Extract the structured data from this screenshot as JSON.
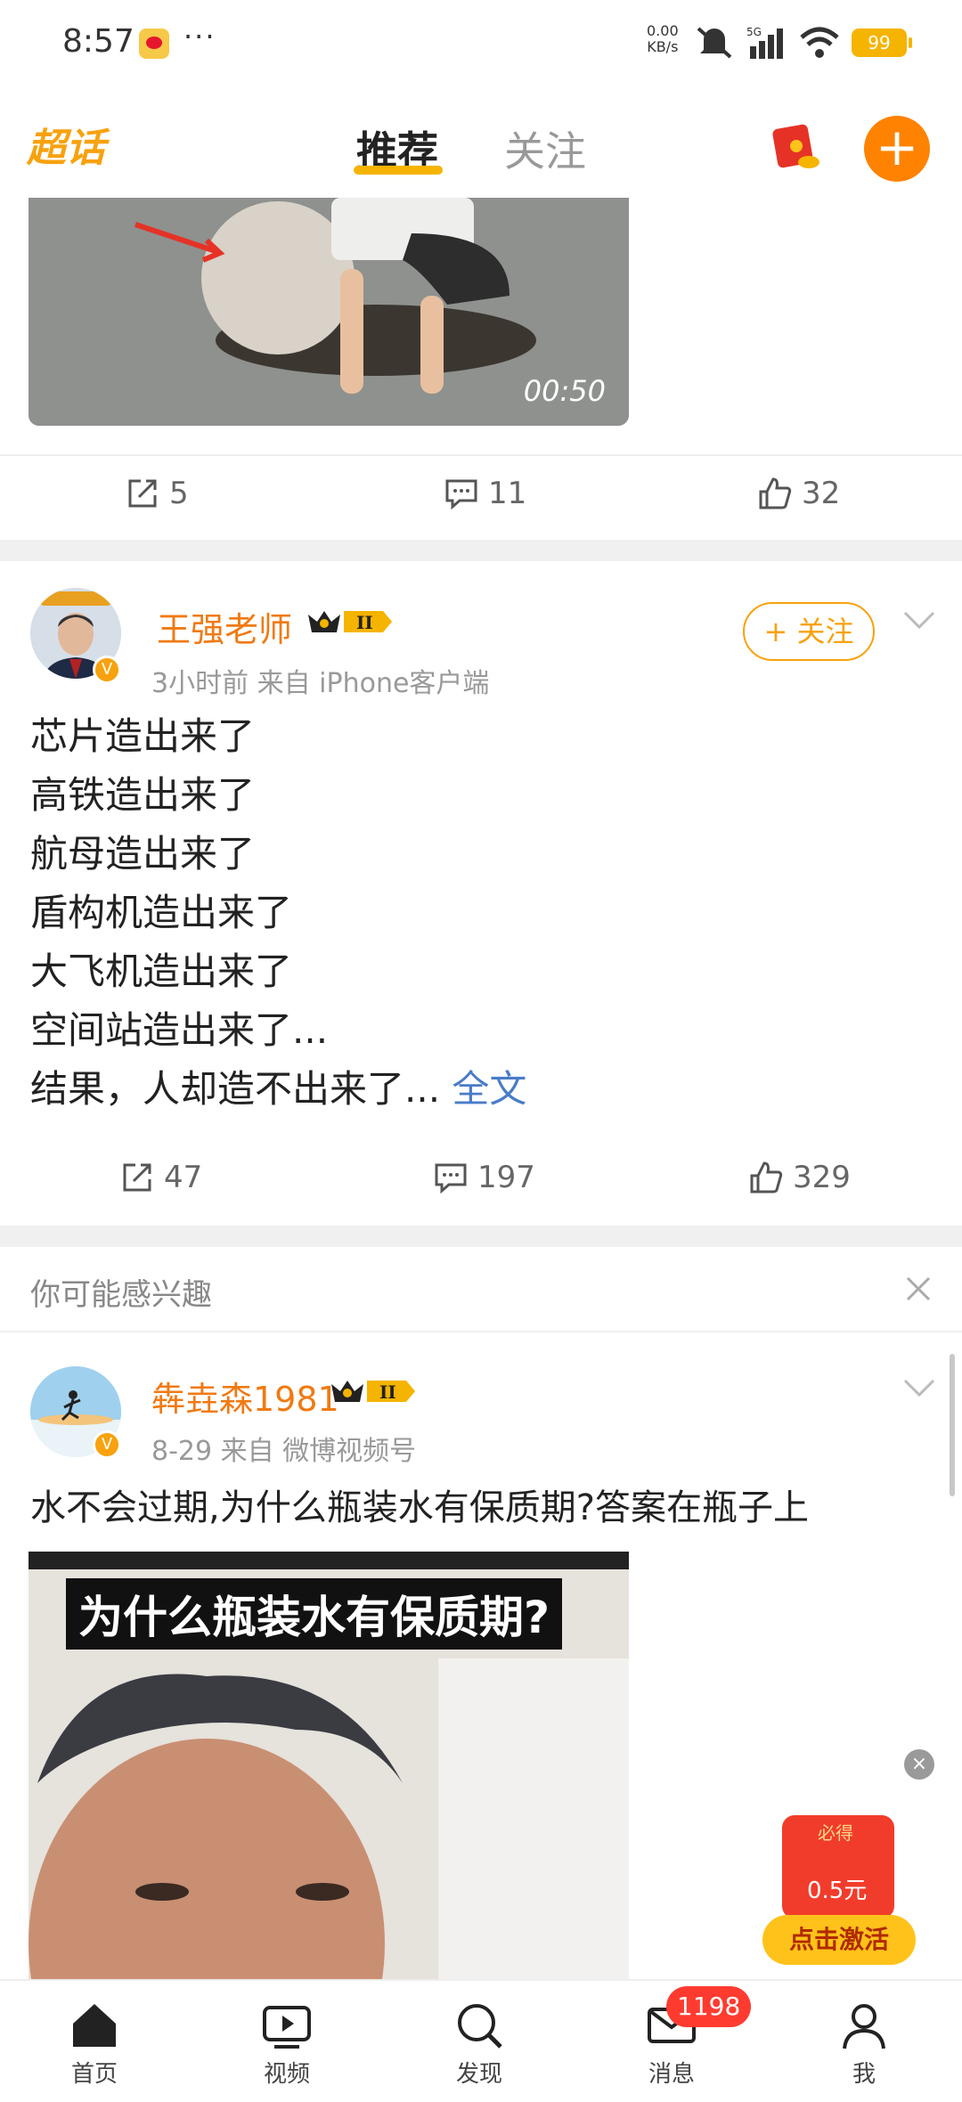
{
  "status_bar": {
    "time": "8:57",
    "network_speed": "0.00",
    "network_unit": "KB/s",
    "signal": "5G",
    "battery": "99"
  },
  "top_nav": {
    "chaohua_label": "超话",
    "tab_recommend": "推荐",
    "tab_follow": "关注",
    "add_label": "+"
  },
  "feed_top": {
    "video_duration": "00:50",
    "repost_count": "5",
    "comment_count": "11",
    "like_count": "32"
  },
  "post_1": {
    "user_name": "王强老师",
    "meta": "3小时前  来自  iPhone客户端",
    "follow_label": "+ 关注",
    "lines": [
      "芯片造出来了",
      "高铁造出来了",
      "航母造出来了",
      "盾构机造出来了",
      "大飞机造出来了",
      "空间站造出来了..."
    ],
    "last_line": "结果，人却造不出来了... ",
    "full_text_label": "全文",
    "repost_count": "47",
    "comment_count": "197",
    "like_count": "329"
  },
  "suggest_section": {
    "title": "你可能感兴趣"
  },
  "post_2": {
    "user_name": "犇垚森1981",
    "meta": "8-29  来自  微博视频号",
    "text": "水不会过期,为什么瓶装水有保质期?答案在瓶子上",
    "video_caption": "为什么瓶装水有保质期?"
  },
  "float_promo": {
    "tag": "必得",
    "amount": "0.5元",
    "cta": "点击激活",
    "close": "×"
  },
  "tabbar": {
    "home": "首页",
    "video": "视频",
    "discover": "发现",
    "messages": "消息",
    "message_badge": "1198",
    "me": "我"
  },
  "colors": {
    "accent_orange": "#ff8200",
    "username_orange": "#f07a13",
    "link_blue": "#4a7cc7",
    "badge_red": "#ff3b30"
  }
}
